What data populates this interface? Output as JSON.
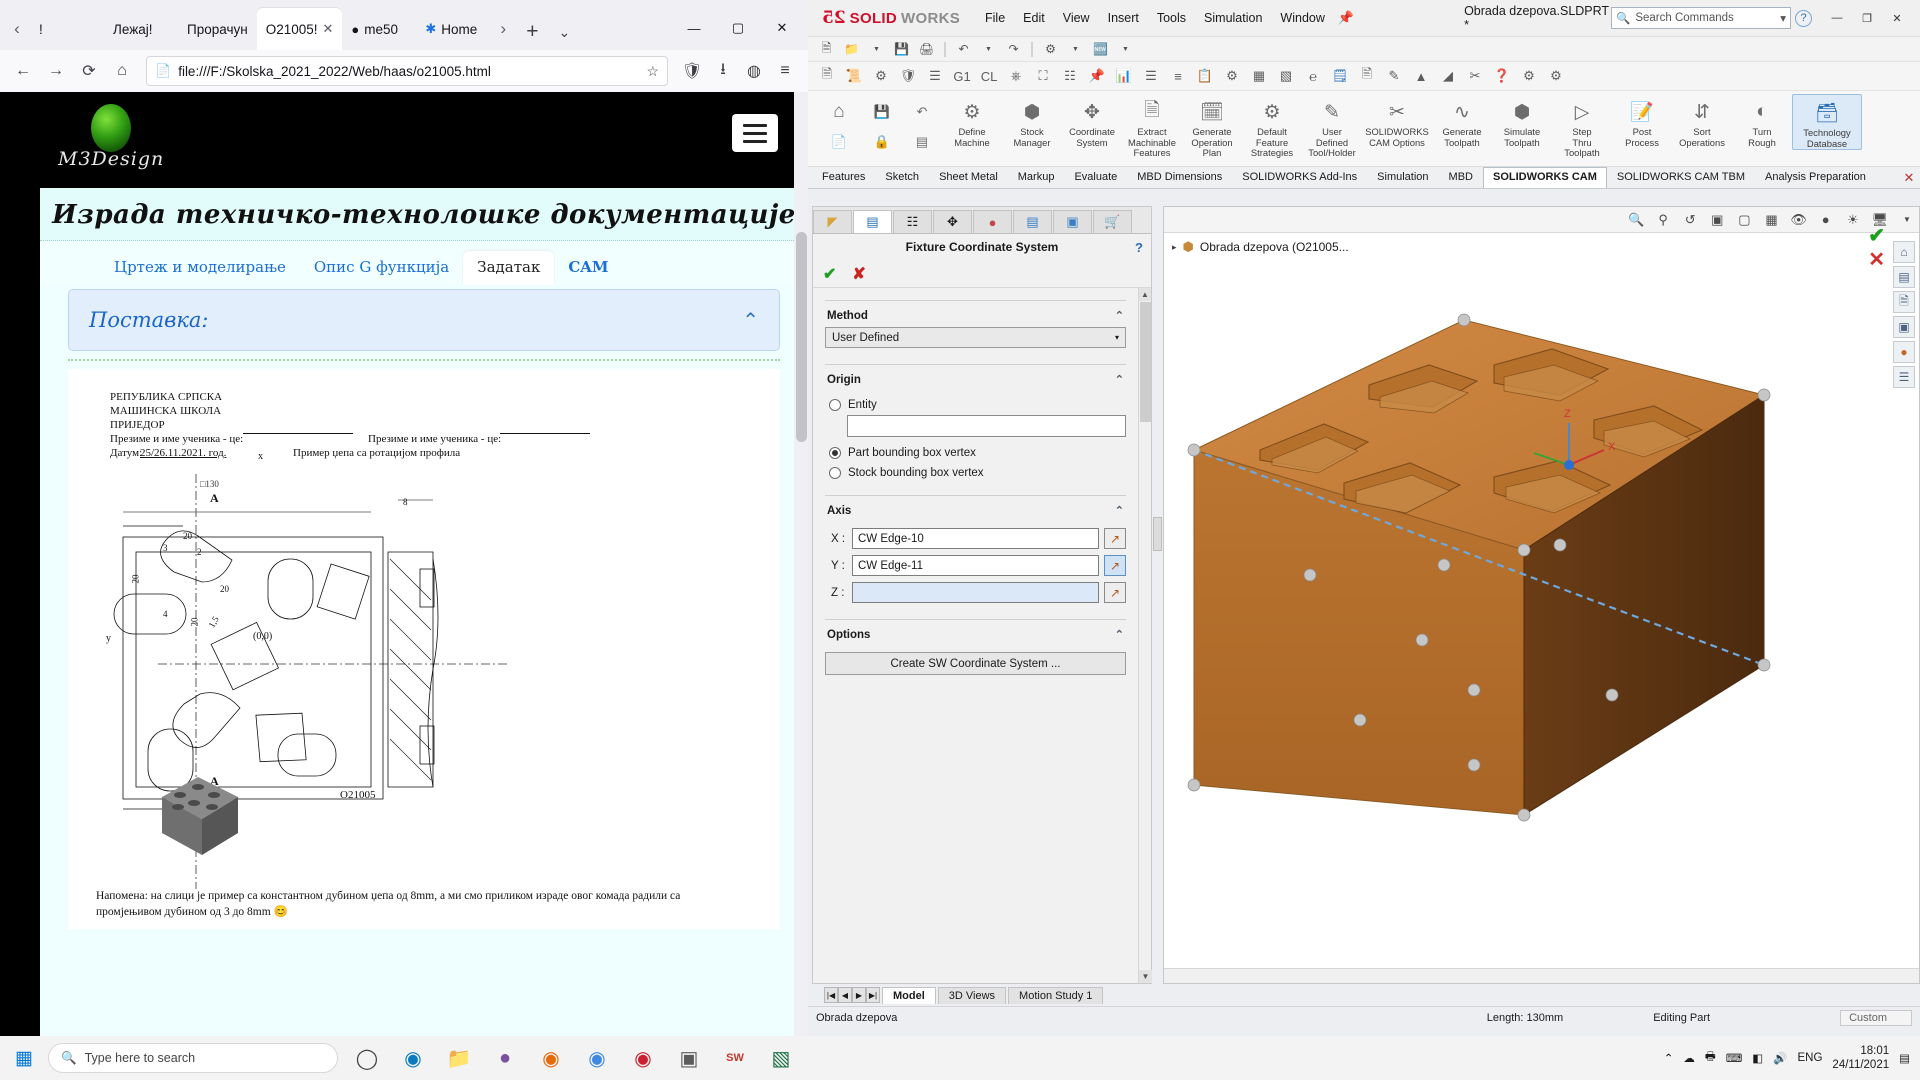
{
  "browser": {
    "tabs": [
      {
        "label": "!",
        "icon": ""
      },
      {
        "label": "Лежај!",
        "icon": ""
      },
      {
        "label": "Прорачун",
        "icon": ""
      },
      {
        "label": "O21005!",
        "icon": "",
        "active": true
      },
      {
        "label": "me50",
        "icon": "github-icon"
      },
      {
        "label": "Home",
        "icon": "firefox-icon"
      }
    ],
    "tab_close_glyph": "✕",
    "scroll_left_glyph": "‹",
    "scroll_right_glyph": "›",
    "new_tab_glyph": "+",
    "list_all_tabs_glyph": "⌄",
    "window_controls": {
      "minimize": "—",
      "maximize": "▢",
      "close": "✕"
    },
    "nav": {
      "back": "←",
      "forward": "→",
      "reload": "⟳",
      "home": "⌂"
    },
    "url": "file:///F:/Skolska_2021_2022/Web/haas/o21005.html",
    "page_icon": "document-icon",
    "bookmark_glyph": "☆",
    "shield_glyph": "🛡",
    "download_glyph": "⭳",
    "account_glyph": "◍",
    "menu_glyph": "≡"
  },
  "webpage": {
    "logo_text": "M3Design",
    "title": "Израда техничко-технолошке документације",
    "tabs": [
      {
        "label": "Цртеж и моделирање",
        "active": false,
        "bold": false
      },
      {
        "label": "Опис G функција",
        "active": false,
        "bold": false
      },
      {
        "label": "Задатак",
        "active": true,
        "bold": false
      },
      {
        "label": "CAM",
        "active": false,
        "bold": true
      }
    ],
    "panel_title": "Поставка:",
    "panel_chevron": "⌃",
    "drawing": {
      "line1": "РЕПУБЛИКА СРПСКА",
      "line2": "МАШИНСКА ШКОЛА",
      "line3": "ПРИЈЕДОР",
      "line4_left": "Презиме и име ученика - це:",
      "line4_right": "Презиме и име ученика - це:",
      "date_label": "Датум:",
      "date_value": "25/26.11.2021. год.",
      "subtitle": "Пример џепа са ротацијом профила",
      "dim_square": "□130",
      "dim_8": "8",
      "dim_20_top": "20",
      "dim_20_left": "20",
      "dim_20_mid": "20",
      "dim_20_bottom": "20",
      "dim_3": "3",
      "dim_2": "2",
      "dim_4": "4",
      "dim_15": "1,5",
      "origin_label": "(0,0)",
      "axis_x": "x",
      "axis_y": "y",
      "section_a_top": "A",
      "section_a_bottom": "A",
      "part_number": "O21005"
    },
    "note": "Напомена: на слици је пример са константном дубином џепа од 8mm, а ми смо приликом израде овог комада радили са промјењивом дубином од 3 до 8mm 😊"
  },
  "solidworks": {
    "brand_mark": "25",
    "brand_word1": "SOLID",
    "brand_word2": "WORKS",
    "menus": [
      "File",
      "Edit",
      "View",
      "Insert",
      "Tools",
      "Simulation",
      "Window"
    ],
    "pin_glyph": "📌",
    "document_title": "Obrada dzepova.SLDPRT *",
    "search_placeholder": "Search Commands",
    "search_dropdown_glyph": "▾",
    "help_glyph": "?",
    "window_controls": {
      "minimize": "—",
      "restore": "❐",
      "close": "✕"
    },
    "ribbon": [
      {
        "label": "Define\nMachine",
        "icon": "machine-icon"
      },
      {
        "label": "Stock\nManager",
        "icon": "stock-icon"
      },
      {
        "label": "Coordinate\nSystem",
        "icon": "coordinate-icon"
      },
      {
        "label": "Extract\nMachinable\nFeatures",
        "icon": "extract-icon"
      },
      {
        "label": "Generate\nOperation\nPlan",
        "icon": "generate-plan-icon"
      },
      {
        "label": "Default\nFeature\nStrategies",
        "icon": "strategies-icon"
      },
      {
        "label": "User\nDefined\nTool/Holder",
        "icon": "tool-holder-icon"
      },
      {
        "label": "SOLIDWORKS\nCAM Options",
        "icon": "cam-options-icon"
      },
      {
        "label": "Generate\nToolpath",
        "icon": "gen-toolpath-icon"
      },
      {
        "label": "Simulate\nToolpath",
        "icon": "sim-toolpath-icon"
      },
      {
        "label": "Step\nThru\nToolpath",
        "icon": "step-thru-icon"
      },
      {
        "label": "Post\nProcess",
        "icon": "post-process-icon"
      },
      {
        "label": "Sort\nOperations",
        "icon": "sort-icon"
      },
      {
        "label": "Turn\nRough",
        "icon": "turn-rough-icon"
      },
      {
        "label": "Technology\nDatabase",
        "icon": "tech-db-icon",
        "highlight": true
      }
    ],
    "command_tabs": [
      {
        "label": "Features",
        "active": false
      },
      {
        "label": "Sketch",
        "active": false
      },
      {
        "label": "Sheet Metal",
        "active": false
      },
      {
        "label": "Markup",
        "active": false
      },
      {
        "label": "Evaluate",
        "active": false
      },
      {
        "label": "MBD Dimensions",
        "active": false
      },
      {
        "label": "SOLIDWORKS Add-Ins",
        "active": false
      },
      {
        "label": "Simulation",
        "active": false
      },
      {
        "label": "MBD",
        "active": false
      },
      {
        "label": "SOLIDWORKS CAM",
        "active": true
      },
      {
        "label": "SOLIDWORKS CAM TBM",
        "active": false
      },
      {
        "label": "Analysis Preparation",
        "active": false
      }
    ],
    "tabs_close_glyph": "✕",
    "property_manager": {
      "tab_icons": [
        "feature-tree-icon",
        "property-manager-icon",
        "configuration-icon",
        "dimxpert-icon",
        "appearances-icon",
        "cam-tree-icon",
        "cam-operation-icon",
        "cam-tool-icon"
      ],
      "title": "Fixture Coordinate System",
      "help_glyph": "?",
      "accept_glyph": "✔",
      "cancel_glyph": "✘",
      "method": {
        "label": "Method",
        "value": "User Defined",
        "caret": "⌃",
        "dropdown_glyph": "▾"
      },
      "origin": {
        "label": "Origin",
        "caret": "⌃",
        "options": [
          {
            "label": "Entity",
            "selected": false
          },
          {
            "label": "Part bounding box vertex",
            "selected": true
          },
          {
            "label": "Stock bounding box vertex",
            "selected": false
          }
        ],
        "entity_value": ""
      },
      "axis": {
        "label": "Axis",
        "caret": "⌃",
        "rows": [
          {
            "label": "X :",
            "value": "CW Edge-10",
            "active": false
          },
          {
            "label": "Y :",
            "value": "CW Edge-11",
            "active": true
          },
          {
            "label": "Z :",
            "value": "",
            "active": false
          }
        ],
        "picker_glyph": "↗"
      },
      "options": {
        "label": "Options",
        "caret": "⌃",
        "button": "Create SW Coordinate System ..."
      }
    },
    "feature_tree_item": "Obrada dzepova  (O21005...",
    "feature_tree_arrow": "▸",
    "confirm_ok": "✔",
    "confirm_cancel": "✕",
    "bottom_tabs": [
      {
        "label": "Model",
        "active": true
      },
      {
        "label": "3D Views",
        "active": false
      },
      {
        "label": "Motion Study 1",
        "active": false
      }
    ],
    "status": {
      "left": "Obrada dzepova",
      "length": "Length: 130mm",
      "editing": "Editing Part",
      "custom": "Custom"
    },
    "axis_labels": {
      "x": "X",
      "y": "Y",
      "z": "Z"
    }
  },
  "taskbar": {
    "start_glyph": "⊞",
    "search_placeholder": "Type here to search",
    "search_icon": "search-icon",
    "icons": [
      {
        "name": "cortana-icon",
        "glyph": "◯"
      },
      {
        "name": "edge-icon",
        "glyph": "◍"
      },
      {
        "name": "file-explorer-icon",
        "glyph": "🗀"
      },
      {
        "name": "viber-icon",
        "glyph": "◐"
      },
      {
        "name": "firefox-icon",
        "glyph": "◉"
      },
      {
        "name": "chrome-icon",
        "glyph": "◎"
      },
      {
        "name": "opera-icon",
        "glyph": "◉"
      },
      {
        "name": "photos-icon",
        "glyph": "▣"
      },
      {
        "name": "solidworks-icon",
        "glyph": "SW"
      },
      {
        "name": "excel-icon",
        "glyph": "X"
      }
    ],
    "tray": {
      "chevron": "⌃",
      "items": [
        "☁",
        "🖶",
        "⌨",
        "◧",
        "🔊"
      ],
      "language": "ENG",
      "time": "18:01",
      "date": "24/11/2021",
      "notification_glyph": "▤"
    }
  }
}
